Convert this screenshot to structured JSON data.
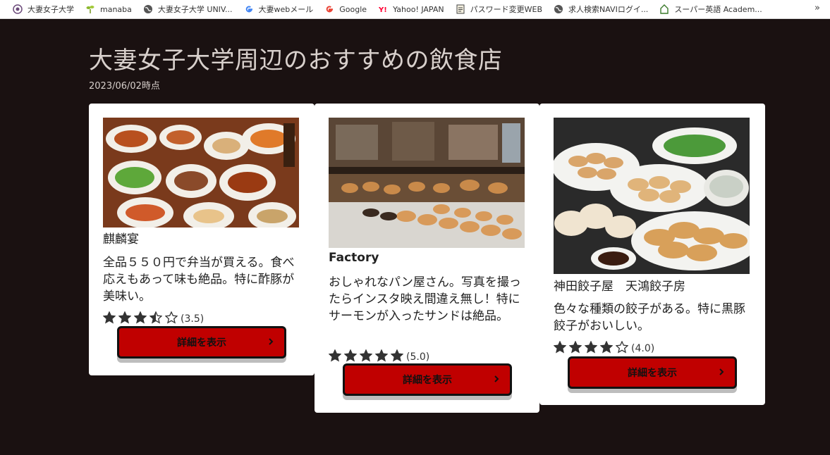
{
  "bookmarks": [
    {
      "label": "大妻女子大学",
      "icon": "university-crest-icon"
    },
    {
      "label": "manaba",
      "icon": "sprout-icon"
    },
    {
      "label": "大妻女子大学 UNIV...",
      "icon": "globe-icon"
    },
    {
      "label": "大妻webメール",
      "icon": "google-g-icon"
    },
    {
      "label": "Google",
      "icon": "google-g-icon"
    },
    {
      "label": "Yahoo! JAPAN",
      "icon": "yahoo-icon"
    },
    {
      "label": "パスワード変更WEB",
      "icon": "document-icon"
    },
    {
      "label": "求人検索NAVIログイ...",
      "icon": "globe-icon"
    },
    {
      "label": "スーパー英語 Academ...",
      "icon": "house-icon"
    }
  ],
  "page": {
    "title": "大妻女子大学周辺のおすすめの飲食店",
    "date": "2023/06/02時点"
  },
  "cards": [
    {
      "name": "麒麟宴",
      "description": "全品５５０円で弁当が買える。食べ応えもあって味も絶品。特に酢豚が美味い。",
      "rating_text": "(3.5)",
      "rating": 3.5,
      "button_label": "詳細を表示",
      "photo": "chinese-dishes-photo"
    },
    {
      "name": "Factory",
      "description": "おしゃれなパン屋さん。写真を撮ったらインスタ映え間違え無し！特にサーモンが入ったサンドは絶品。",
      "rating_text": "(5.0)",
      "rating": 5.0,
      "button_label": "詳細を表示",
      "photo": "bakery-photo"
    },
    {
      "name": "神田餃子屋　天鴻餃子房",
      "description": "色々な種類の餃子がある。特に黒豚餃子がおいしい。",
      "rating_text": "(4.0)",
      "rating": 4.0,
      "button_label": "詳細を表示",
      "photo": "gyoza-photo"
    }
  ],
  "colors": {
    "background": "#1a1111",
    "button": "#c00000",
    "title_text": "#d8d0cc"
  }
}
